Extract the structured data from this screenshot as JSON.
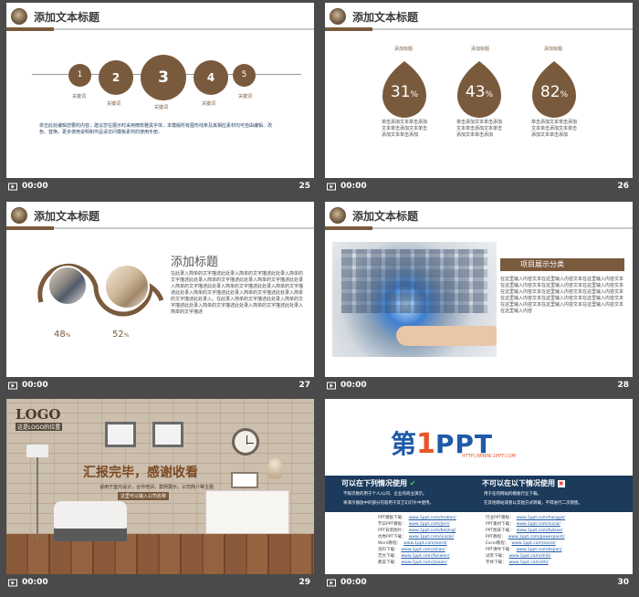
{
  "slides": [
    {
      "number": "25",
      "time": "00:00",
      "title": "添加文本标题",
      "steps": [
        {
          "n": "1",
          "label": "关键词"
        },
        {
          "n": "2",
          "label": "关键词"
        },
        {
          "n": "3",
          "label": "关键词"
        },
        {
          "n": "4",
          "label": "关键词"
        },
        {
          "n": "5",
          "label": "关键词"
        }
      ],
      "body": "单击此处编辑您要的内容，建议您在展示时采用微软雅黑字体，本模版所有图形线条及其相应素材均可自由编辑、改色、替换。更多使用说明和作品请访问模板素材的使用手册。"
    },
    {
      "number": "26",
      "time": "00:00",
      "title": "添加文本标题",
      "items": [
        {
          "label": "添加标题",
          "value": "31",
          "unit": "%",
          "text": "单击添加文本单击添加文本单击添加文本单击添加文本单击添加"
        },
        {
          "label": "添加标题",
          "value": "43",
          "unit": "%",
          "text": "单击添加文本单击添加文本单击添加文本单击添加文本单击添加"
        },
        {
          "label": "添加标题",
          "value": "82",
          "unit": "%",
          "text": "单击添加文本单击添加文本单击添加文本单击添加文本单击添加"
        }
      ]
    },
    {
      "number": "27",
      "time": "00:00",
      "title": "添加文本标题",
      "heading": "添加标题",
      "left_pct": "48",
      "right_pct": "52",
      "pct_unit": "%",
      "body": "在此录入简单的文字描述此处录入简单的文字描述此处录入简单的文字描述此处录入简单的文字描述此处录入简单的文字描述此处录入简单的文字描述此处录入简单的文字描述此处录入简单的文字描述此处录入简单的文字描述此处录入简单的文字描述此处录入简单的文字描述此处录入。在此录入简单的文字描述此处录入简单的文字描述此处录入简单的文字描述此处录入简单的文字描述此处录入简单的文字描述"
    },
    {
      "number": "28",
      "time": "00:00",
      "title": "添加文本标题",
      "banner": "项目展示分类",
      "body": "在这里输入内容文本在这里输入内容文本在这里输入内容文本在这里输入内容文本在这里输入内容文本在这里输入内容文本在这里输入内容文本在这里输入内容文本在这里输入内容文本在这里输入内容文本在这里输入内容文本在这里输入内容文本在这里输入内容文本在这里输入内容文本在这里输入内容文本在这里输入内容"
    },
    {
      "number": "29",
      "time": "00:00",
      "logo": "LOGO",
      "logo_sub": "这是LOGO的位置",
      "headline": "汇报完毕，感谢收看",
      "sub1": "适用于室内设计，合作培训，案例展示，公司简介等主题",
      "sub2": "这里可以输入公司名称"
    },
    {
      "number": "30",
      "time": "00:00",
      "brand_main": "第",
      "brand_one": "1",
      "brand_ppt": "PPT",
      "brand_url": "HTTP://WWW.1PPT.COM",
      "can_title": "可以在下列情况使用",
      "cannot_title": "不可以在以下情况使用",
      "can_items": [
        "不限次数的用于个人/公司、企业的商业演示。",
        "将演示播放中的部分内容用于其它幻灯片中使用。"
      ],
      "cannot_items": [
        "用于任何网站的模板行业下载。",
        "在其他网站或者以其他方式转载，不得进行二次销售。"
      ],
      "links_left": [
        {
          "k": "PPT模板下载：",
          "v": "www.1ppt.com/moban/"
        },
        {
          "k": "节日PPT模板：",
          "v": "www.1ppt.com/jieri/"
        },
        {
          "k": "PPT背景图片：",
          "v": "www.1ppt.com/beijing/"
        },
        {
          "k": "优秀PPT下载：",
          "v": "www.1ppt.com/xiazai/"
        },
        {
          "k": "Word教程：",
          "v": "www.1ppt.com/word/"
        },
        {
          "k": "资料下载：",
          "v": "www.1ppt.com/ziliao/"
        },
        {
          "k": "范文下载：",
          "v": "www.1ppt.com/fanwen/"
        },
        {
          "k": "教案下载：",
          "v": "www.1ppt.com/jiaoan/"
        }
      ],
      "links_right": [
        {
          "k": "行业PPT模板：",
          "v": "www.1ppt.com/hangye/"
        },
        {
          "k": "PPT素材下载：",
          "v": "www.1ppt.com/sucai/"
        },
        {
          "k": "PPT图表下载：",
          "v": "www.1ppt.com/tubiao/"
        },
        {
          "k": "PPT教程：",
          "v": "www.1ppt.com/powerpoint/"
        },
        {
          "k": "Excel教程：",
          "v": "www.1ppt.com/excel/"
        },
        {
          "k": "PPT课件下载：",
          "v": "www.1ppt.com/kejian/"
        },
        {
          "k": "试卷下载：",
          "v": "www.1ppt.com/shiti/"
        },
        {
          "k": "字体下载：",
          "v": "www.1ppt.com/ziti/"
        }
      ]
    }
  ],
  "colors": {
    "accent": "#7a5a3d",
    "navy": "#1b3a5c",
    "bg": "#4a4a4a"
  }
}
